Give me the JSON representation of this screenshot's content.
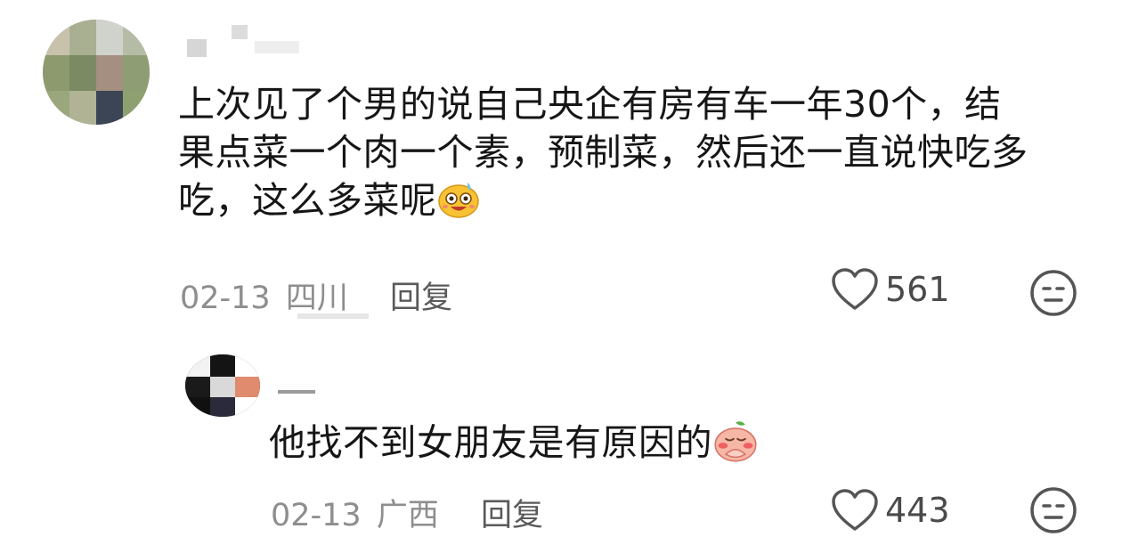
{
  "comments": [
    {
      "text_line_1": "上次见了个男的说自己央企有房有车一年30个，结",
      "text_line_2": "果点菜一个肉一个素，预制菜，然后还一直说快吃多",
      "text_line_3": "吃，这么多菜呢",
      "emoji": "smiling-sweat-emoji",
      "date": "02-13",
      "location": "四川",
      "reply_label": "回复",
      "like_count": "561",
      "like_icon": "heart-icon",
      "dislike_icon": "meh-face-icon"
    },
    {
      "text_line_1": "他找不到女朋友是有原因的",
      "emoji": "peach-shy-emoji",
      "date": "02-13",
      "location": "广西",
      "reply_label": "回复",
      "like_count": "443",
      "like_icon": "heart-icon",
      "dislike_icon": "meh-face-icon"
    }
  ]
}
